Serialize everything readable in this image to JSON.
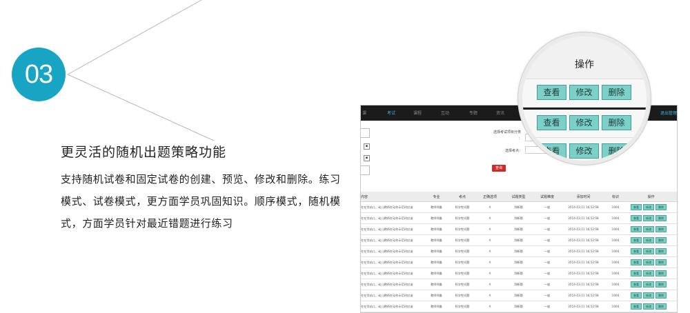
{
  "step_number": "03",
  "feature": {
    "title": "更灵活的随机出题策略功能",
    "description": "支持随机试卷和固定试卷的创建、预览、修改和删除。练习模式、试卷模式，更方面学员巩固知识。顺序模式，随机模式，方面学员针对最近错题进行练习"
  },
  "screenshot": {
    "nav": [
      "考试",
      "课程",
      "互动",
      "专题",
      "资讯"
    ],
    "nav_partial_left": "课",
    "nav_right": "退出管理",
    "filter": {
      "category_label": "选择考试项目分类",
      "category_colon": "：",
      "point_label": "选择考点：",
      "search_button": "查询"
    },
    "checkbox_mark": "▪",
    "table": {
      "columns": [
        "内容",
        "专业",
        "考点",
        "正确选项",
        "试题类型",
        "试题难度",
        "添加时间",
        "标识",
        "操作"
      ],
      "rows": [
        [
          "在在为幼儿、幼儿教师在动作示范时应该",
          "教师师备",
          "科学性问题",
          "A",
          "判断题",
          "一般",
          "2014-03-11 16:52:08",
          "1004"
        ],
        [
          "在在为幼儿、幼儿教师在动作示范时应该",
          "教师师备",
          "科学性问题",
          "A",
          "判断题",
          "一般",
          "2014-03-11 16:52:08",
          "1004"
        ],
        [
          "在在为幼儿、幼儿教师在动作示范时应该",
          "教师师备",
          "科学性问题",
          "A",
          "判断题",
          "一般",
          "2014-03-11 16:52:08",
          "1004"
        ],
        [
          "在在为幼儿、幼儿教师在动作示范时应该",
          "教师师备",
          "科学性问题",
          "A",
          "判断题",
          "一般",
          "2014-03-11 16:52:08",
          "1004"
        ],
        [
          "在在为幼儿、幼儿教师在动作示范时应该",
          "教师师备",
          "科学性问题",
          "A",
          "判断题",
          "一般",
          "2014-03-11 16:52:08",
          "1004"
        ],
        [
          "在在为幼儿、幼儿教师在动作示范时应该",
          "教师师备",
          "科学性问题",
          "A",
          "判断题",
          "一般",
          "2014-03-11 16:52:08",
          "1004"
        ],
        [
          "在在为幼儿、幼儿教师在动作示范时应该",
          "教师师备",
          "科学性问题",
          "A",
          "判断题",
          "一般",
          "2014-03-11 16:52:08",
          "1004"
        ],
        [
          "在在为幼儿、幼儿教师在动作示范时应该",
          "教师师备",
          "科学性问题",
          "A",
          "判断题",
          "一般",
          "2014-03-11 16:52:08",
          "1004"
        ],
        [
          "在在为幼儿、幼儿教师在动作示范时应该",
          "教师师备",
          "科学性问题",
          "A",
          "判断题",
          "一般",
          "2014-03-11 16:52:08",
          "1004"
        ],
        [
          "在在为幼儿、幼儿教师在动作示范时应该",
          "教师师备",
          "科学性问题",
          "A",
          "判断题",
          "一般",
          "2014-03-11 16:52:08",
          "1004"
        ]
      ],
      "row_actions": [
        "查看",
        "修改",
        "删除"
      ]
    }
  },
  "zoom": {
    "header": "操作",
    "actions": [
      "查看",
      "修改",
      "删除"
    ]
  },
  "colors": {
    "accent_teal": "#18a5c3",
    "nav_background": "#1b1b1b",
    "nav_active": "#3db6d8",
    "action_button": "#7dd0c8",
    "search_button": "#cf2a2a"
  }
}
